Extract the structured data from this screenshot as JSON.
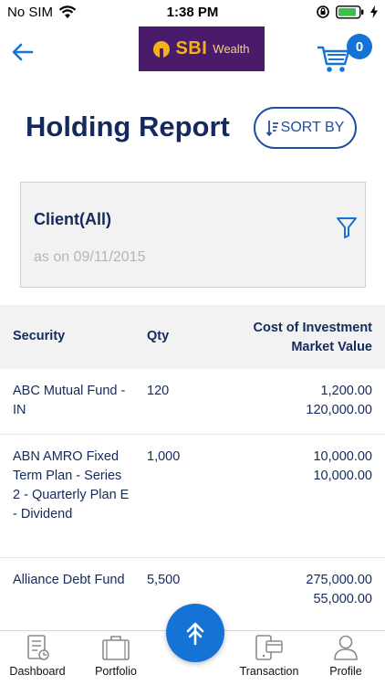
{
  "status_bar": {
    "carrier": "No SIM",
    "time": "1:38 PM"
  },
  "header": {
    "logo_brand": "SBI",
    "logo_sub": "Wealth",
    "cart_count": "0"
  },
  "page": {
    "title": "Holding Report",
    "sort_label": "SORT BY"
  },
  "client_card": {
    "title": "Client(All)",
    "date": "as on 09/11/2015"
  },
  "table": {
    "headers": {
      "security": "Security",
      "qty": "Qty",
      "value_line1": "Cost of Investment",
      "value_line2": "Market Value"
    },
    "rows": [
      {
        "security": "ABC Mutual Fund - IN",
        "qty": "120",
        "cost": "1,200.00",
        "market": "120,000.00"
      },
      {
        "security": "ABN AMRO Fixed Term Plan - Series 2 - Quarterly Plan E - Dividend",
        "qty": "1,000",
        "cost": "10,000.00",
        "market": "10,000.00"
      },
      {
        "security": "Alliance Debt Fund",
        "qty": "5,500",
        "cost": "275,000.00",
        "market": "55,000.00"
      }
    ]
  },
  "tabs": [
    {
      "label": "Dashboard",
      "icon": "dashboard-icon"
    },
    {
      "label": "Portfolio",
      "icon": "briefcase-icon"
    },
    {
      "label": "Transaction",
      "icon": "transaction-icon"
    },
    {
      "label": "Profile",
      "icon": "profile-icon"
    }
  ],
  "colors": {
    "primary": "#1573d6",
    "title": "#142a5c",
    "logo_bg": "#4a1a6b",
    "logo_gold": "#f3b21a"
  }
}
